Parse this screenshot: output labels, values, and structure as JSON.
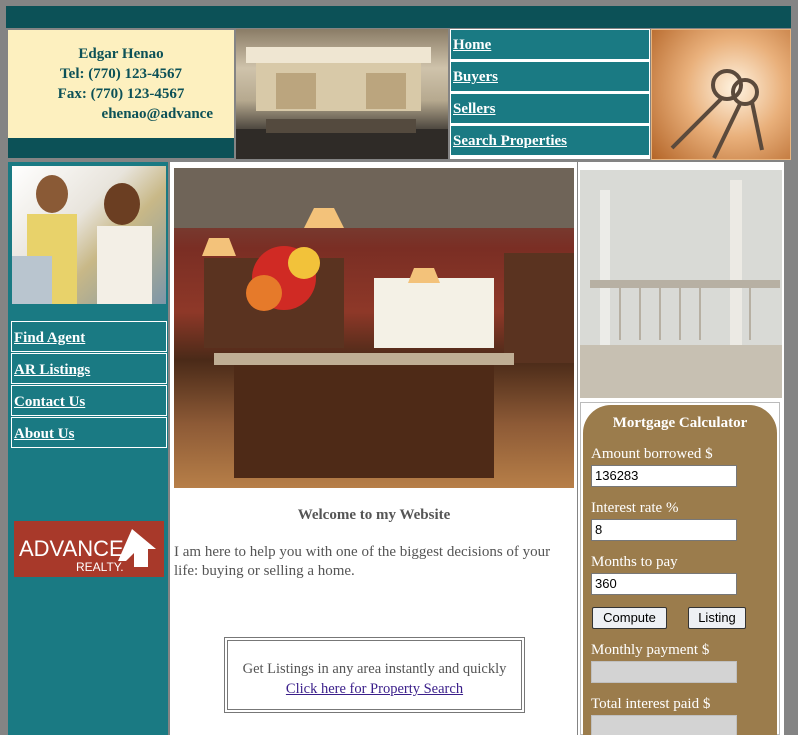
{
  "contact": {
    "name": "Edgar Henao",
    "tel": "Tel: (770) 123-4567",
    "fax": "Fax: (770) 123-4567",
    "email": "ehenao@advance"
  },
  "topnav": [
    "Home",
    "Buyers",
    "Sellers",
    "Search Properties"
  ],
  "sidenav": [
    "Find Agent",
    "AR Listings",
    "Contact Us",
    "About Us"
  ],
  "logo": {
    "word1": "ADVANCE",
    "word2": "REALTY."
  },
  "main": {
    "welcome": "Welcome to my Website",
    "intro": "I am here to help you with one of the biggest decisions of your life: buying or selling a home.",
    "search_text": "Get Listings in any area instantly and quickly",
    "search_link": "Click here for Property Search"
  },
  "calculator": {
    "title": "Mortgage Calculator",
    "amount_label": "Amount borrowed $",
    "amount_value": "136283",
    "rate_label": "Interest rate %",
    "rate_value": "8",
    "months_label": "Months to pay",
    "months_value": "360",
    "compute_label": "Compute",
    "listing_label": "Listing",
    "monthly_label": "Monthly payment $",
    "interest_label": "Total interest paid $"
  },
  "colors": {
    "teal": "#1a7a83",
    "dark_teal": "#0c5157",
    "cream": "#fdf0bf",
    "calc_brown": "#9b7c4c",
    "logo_red": "#a8392a"
  }
}
